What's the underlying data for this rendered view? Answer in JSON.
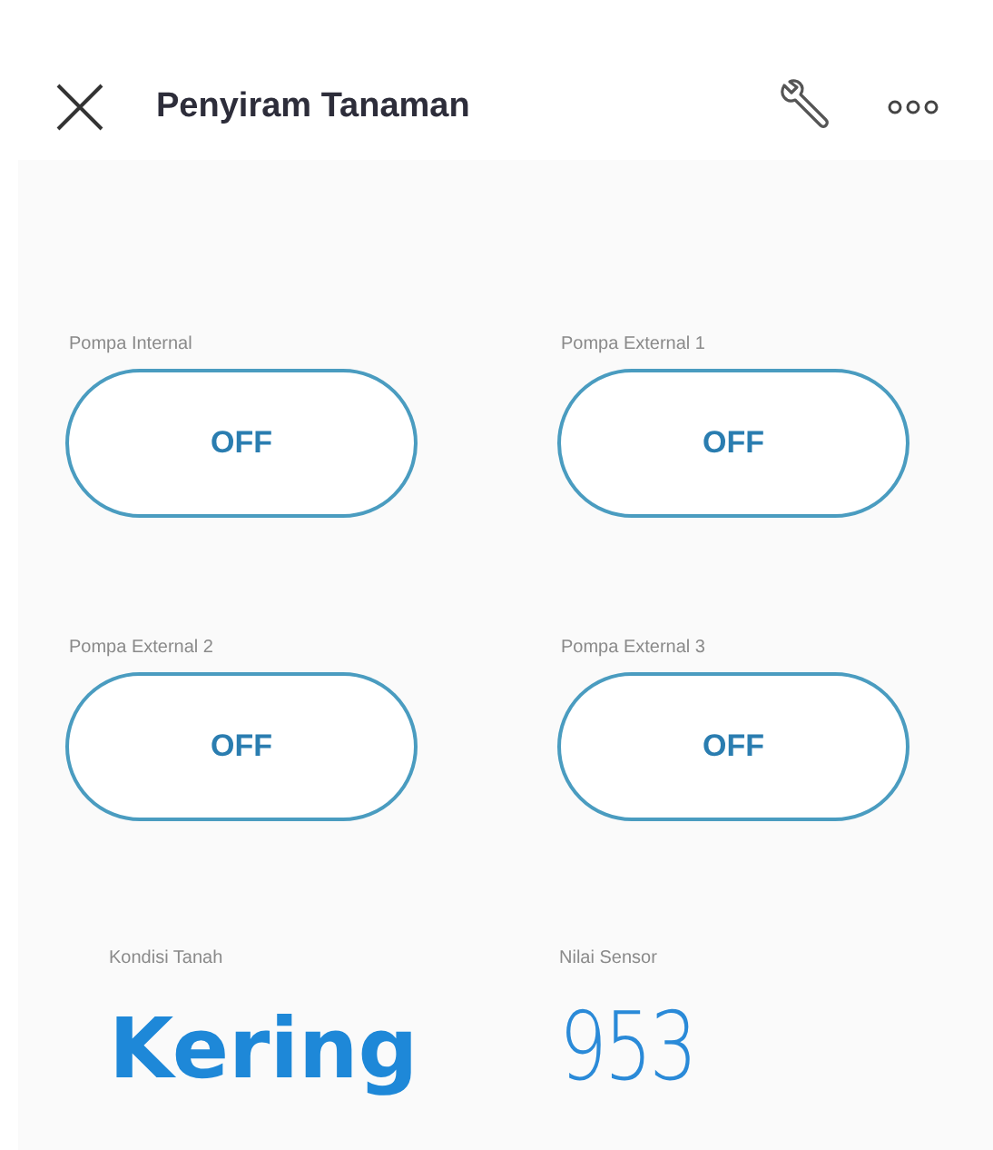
{
  "header": {
    "title": "Penyiram Tanaman"
  },
  "switches": [
    {
      "label": "Pompa Internal",
      "state_text": "OFF",
      "on": false
    },
    {
      "label": "Pompa External 1",
      "state_text": "OFF",
      "on": false
    },
    {
      "label": "Pompa External 2",
      "state_text": "OFF",
      "on": false
    },
    {
      "label": "Pompa External 3",
      "state_text": "OFF",
      "on": false
    }
  ],
  "displays": [
    {
      "label": "Kondisi Tanah",
      "value": "Kering",
      "kind": "text"
    },
    {
      "label": "Nilai Sensor",
      "value": "953",
      "kind": "number"
    }
  ]
}
